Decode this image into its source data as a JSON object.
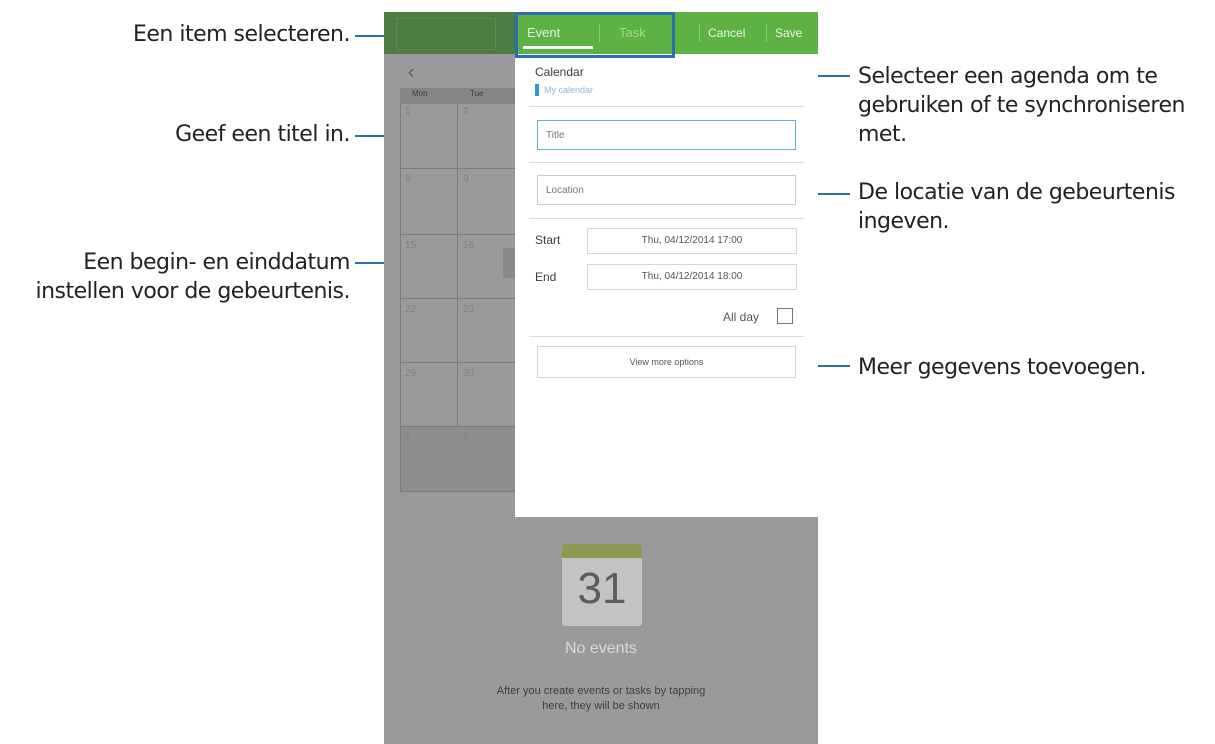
{
  "callouts": {
    "select_item": "Een item selecteren.",
    "title": "Geef een titel in.",
    "dates_line1": "Een begin- en einddatum",
    "dates_line2": "instellen voor de gebeurtenis.",
    "calendar_line1": "Selecteer een agenda om te",
    "calendar_line2": "gebruiken of te synchroniseren",
    "calendar_line3": "met.",
    "location_line1": "De locatie van de gebeurtenis",
    "location_line2": "ingeven.",
    "more": "Meer gegevens toevoegen."
  },
  "dialog": {
    "tabs": {
      "event": "Event",
      "task": "Task"
    },
    "cancel": "Cancel",
    "save": "Save",
    "calendar_label": "Calendar",
    "calendar_value": "My calendar",
    "title_placeholder": "Title",
    "location_placeholder": "Location",
    "start_label": "Start",
    "start_value": "Thu, 04/12/2014  17:00",
    "end_label": "End",
    "end_value": "Thu, 04/12/2014  18:00",
    "all_day_label": "All day",
    "all_day_checked": false,
    "more_options": "View more options"
  },
  "background": {
    "weekday_headers": [
      "Mon",
      "Tue"
    ],
    "dates": [
      [
        "1",
        "2"
      ],
      [
        "8",
        "9"
      ],
      [
        "15",
        "16"
      ],
      [
        "22",
        "23"
      ],
      [
        "29",
        "30"
      ],
      [
        "5",
        "6"
      ]
    ],
    "no_events_day": "31",
    "no_events_title": "No events",
    "no_events_desc": "After you create events or tasks by tapping here, they will be shown"
  },
  "colors": {
    "accent_green": "#5eb243",
    "callout_line": "#2a6fb0",
    "calendar_marker": "#2c9ad4"
  }
}
